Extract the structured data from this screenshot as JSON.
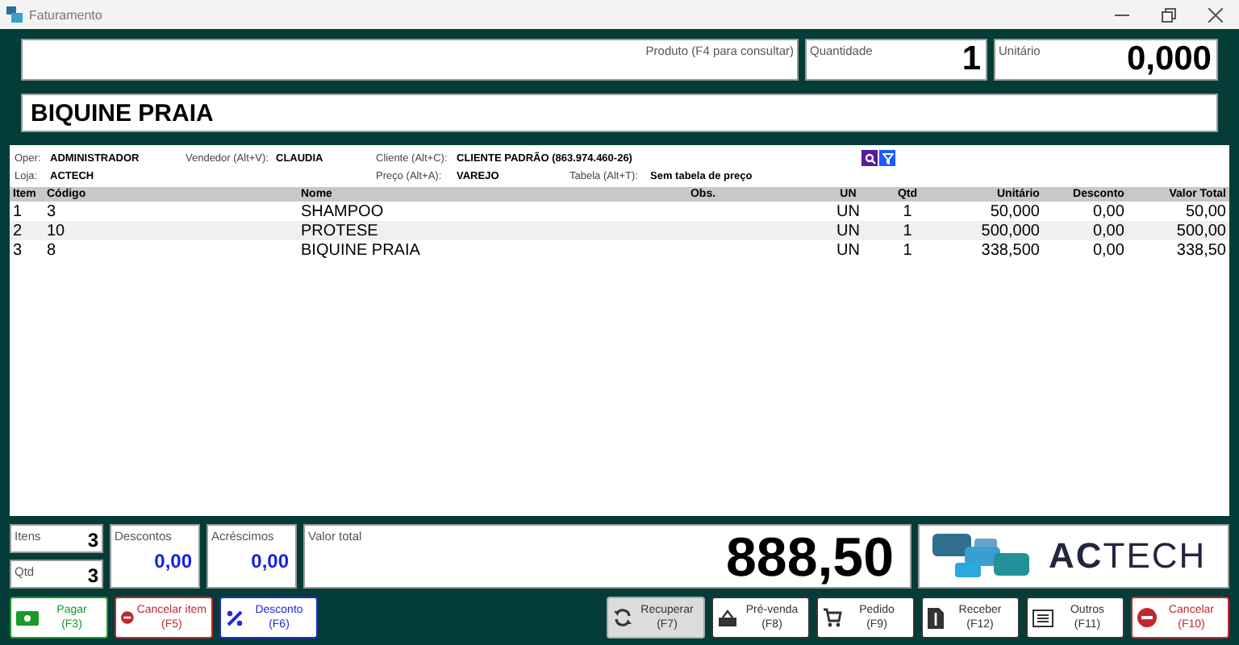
{
  "window": {
    "title": "Faturamento"
  },
  "product": {
    "label": "Produto (F4 para consultar)"
  },
  "quantity": {
    "label": "Quantidade",
    "value": "1"
  },
  "unit_price": {
    "label": "Unitário",
    "value": "0,000"
  },
  "product_name": "BIQUINE PRAIA",
  "info": [
    {
      "label": "Oper:",
      "value": "ADMINISTRADOR"
    },
    {
      "label": "Vendedor (Alt+V):",
      "value": "CLAUDIA"
    },
    {
      "label": "Cliente (Alt+C):",
      "value": "CLIENTE PADRÃO (863.974.460-26)"
    },
    {
      "label": "Loja:",
      "value": "ACTECH"
    },
    {
      "label": "Preço (Alt+A):",
      "value": "VAREJO"
    },
    {
      "label": "Tabela (Alt+T):",
      "value": "Sem tabela de preço"
    }
  ],
  "table": {
    "columns": [
      "Item",
      "Código",
      "Nome",
      "Obs.",
      "UN",
      "Qtd",
      "Unitário",
      "Desconto",
      "Valor Total"
    ],
    "rows": [
      [
        "1",
        "3",
        "SHAMPOO",
        "",
        "UN",
        "1",
        "50,000",
        "0,00",
        "50,00"
      ],
      [
        "2",
        "10",
        "PROTESE",
        "",
        "UN",
        "1",
        "500,000",
        "0,00",
        "500,00"
      ],
      [
        "3",
        "8",
        "BIQUINE PRAIA",
        "",
        "UN",
        "1",
        "338,500",
        "0,00",
        "338,50"
      ]
    ]
  },
  "totals": {
    "items": {
      "label": "Itens",
      "value": "3"
    },
    "qty": {
      "label": "Qtd",
      "value": "3"
    },
    "discounts": {
      "label": "Descontos",
      "value": "0,00"
    },
    "additions": {
      "label": "Acréscimos",
      "value": "0,00"
    },
    "total": {
      "label": "Valor total",
      "value": "888,50"
    }
  },
  "logo": {
    "text_bold": "AC",
    "text": "TECH"
  },
  "buttons_left": [
    {
      "label": "Pagar",
      "key": "(F3)",
      "kind": "cash",
      "color": "#1a9a2a",
      "hovered": false
    },
    {
      "label": "Cancelar item",
      "key": "(F5)",
      "kind": "stop",
      "color": "#c0282d",
      "hovered": false
    },
    {
      "label": "Desconto",
      "key": "(F6)",
      "kind": "percent",
      "color": "#1d2bd8",
      "hovered": false
    }
  ],
  "buttons_right": [
    {
      "label": "Recuperar",
      "key": "(F7)",
      "kind": "refresh",
      "color": "#333333",
      "hovered": true
    },
    {
      "label": "Pré-venda",
      "key": "(F8)",
      "kind": "basket",
      "color": "#333333",
      "hovered": false
    },
    {
      "label": "Pedido",
      "key": "(F9)",
      "kind": "cart",
      "color": "#333333",
      "hovered": false
    },
    {
      "label": "Receber",
      "key": "(F12)",
      "kind": "receipt",
      "color": "#333333",
      "hovered": false
    },
    {
      "label": "Outros",
      "key": "(F11)",
      "kind": "list",
      "color": "#333333",
      "hovered": false
    },
    {
      "label": "Cancelar",
      "key": "(F10)",
      "kind": "stop",
      "color": "#c0282d",
      "hovered": false
    }
  ]
}
